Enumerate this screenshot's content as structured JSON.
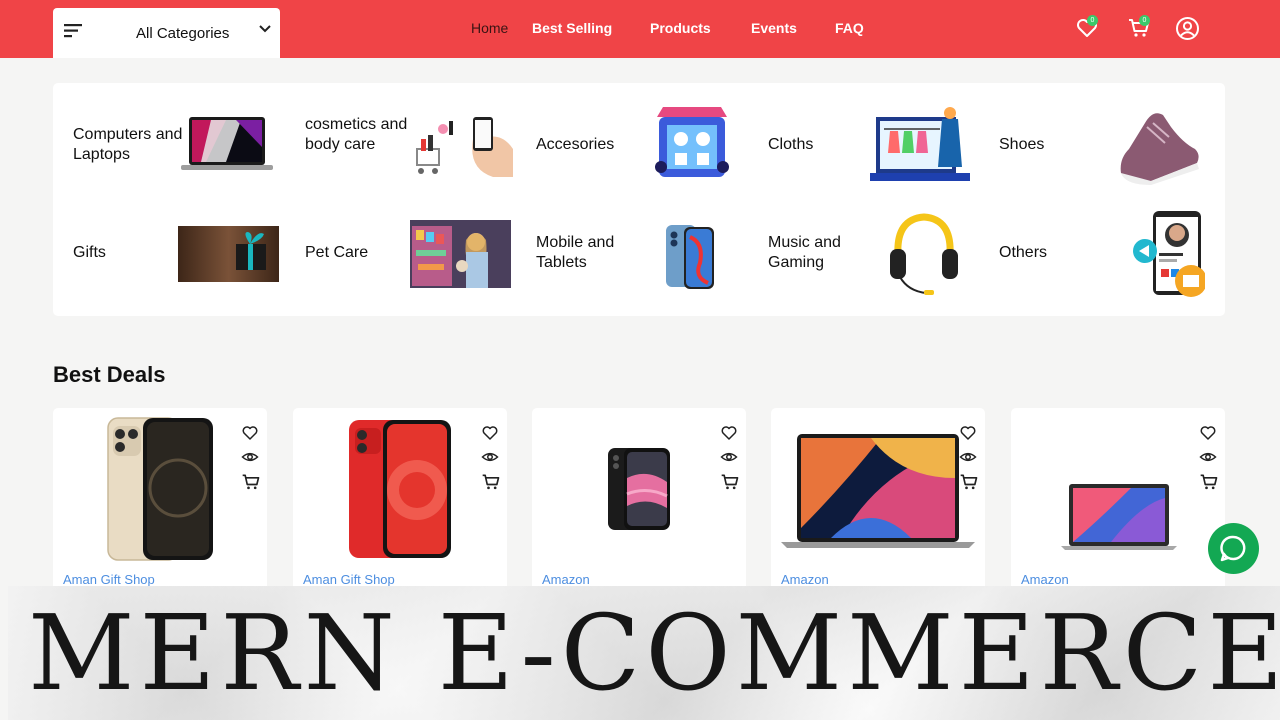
{
  "header": {
    "category_button": "All Categories",
    "nav": [
      {
        "label": "Home",
        "active": true
      },
      {
        "label": "Best Selling",
        "active": false
      },
      {
        "label": "Products",
        "active": false
      },
      {
        "label": "Events",
        "active": false
      },
      {
        "label": "FAQ",
        "active": false
      }
    ],
    "wishlist_count": "0",
    "cart_count": "0",
    "icons": [
      "menu-icon",
      "chevron-down-icon",
      "heart-icon",
      "cart-icon",
      "user-icon"
    ]
  },
  "categories": [
    {
      "label": "Computers and Laptops",
      "icon": "laptop-image"
    },
    {
      "label": "cosmetics and body care",
      "icon": "cosmetics-image"
    },
    {
      "label": "Accesories",
      "icon": "accessories-image"
    },
    {
      "label": "Cloths",
      "icon": "cloths-image"
    },
    {
      "label": "Shoes",
      "icon": "shoes-image"
    },
    {
      "label": "Gifts",
      "icon": "gift-image"
    },
    {
      "label": "Pet Care",
      "icon": "pet-care-image"
    },
    {
      "label": "Mobile and Tablets",
      "icon": "phone-image"
    },
    {
      "label": "Music and Gaming",
      "icon": "headphones-image"
    },
    {
      "label": "Others",
      "icon": "others-image"
    }
  ],
  "deals": {
    "title": "Best Deals",
    "products": [
      {
        "shop": "Aman Gift Shop",
        "image": "iphone-gold-image"
      },
      {
        "shop": "Aman Gift Shop",
        "image": "iphone-red-image"
      },
      {
        "shop": "Amazon",
        "image": "iphone-black-image"
      },
      {
        "shop": "Amazon",
        "image": "macbook-pro-image"
      },
      {
        "shop": "Amazon",
        "image": "macbook-air-image"
      }
    ]
  },
  "banner": {
    "title": "MERN E-COMMERCE"
  },
  "colors": {
    "header_bg": "#f04447",
    "shop_link": "#4d8ee0",
    "chat_bg": "#13a853",
    "badge": "#3bc96a"
  }
}
